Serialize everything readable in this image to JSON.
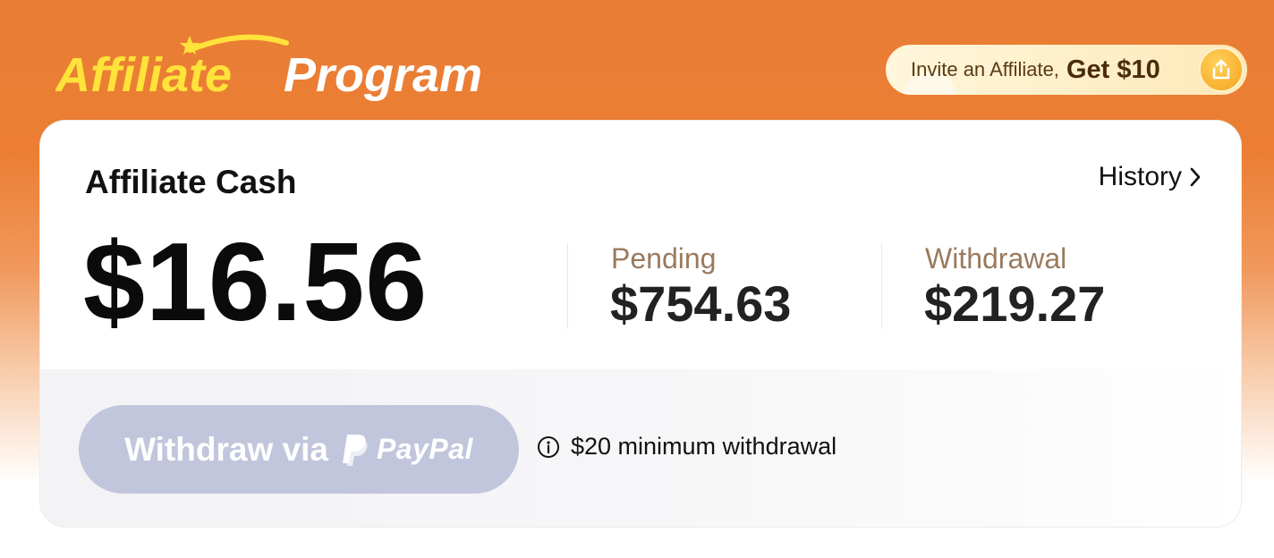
{
  "header": {
    "logo_word_1": "Affiliate",
    "logo_word_2": "Program",
    "invite": {
      "text": "Invite an Affiliate,",
      "amount": "Get $10",
      "icon": "share-icon"
    }
  },
  "card": {
    "title": "Affiliate Cash",
    "history_label": "History",
    "balance": "$16.56",
    "stats": [
      {
        "label": "Pending",
        "value": "$754.63"
      },
      {
        "label": "Withdrawal",
        "value": "$219.27"
      }
    ],
    "withdraw_button": {
      "label": "Withdraw via",
      "provider": "PayPal"
    },
    "min_note": "$20 minimum withdrawal"
  },
  "colors": {
    "header_orange": "#eb7e33",
    "logo_yellow": "#ffe23a",
    "button_disabled": "#c2c6dc",
    "stat_label": "#9a7a5e"
  }
}
